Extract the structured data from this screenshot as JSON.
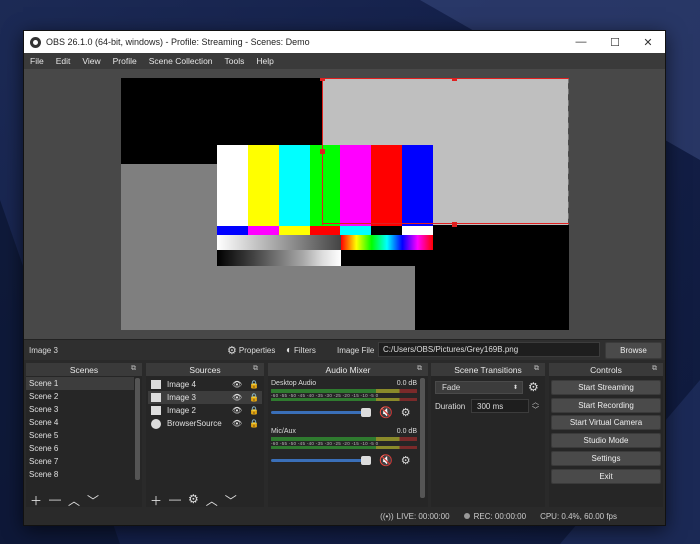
{
  "window": {
    "title": "OBS 26.1.0 (64-bit, windows) - Profile: Streaming - Scenes: Demo"
  },
  "menu": [
    "File",
    "Edit",
    "View",
    "Profile",
    "Scene Collection",
    "Tools",
    "Help"
  ],
  "properties_bar": {
    "source_name": "Image 3",
    "properties_label": "Properties",
    "filters_label": "Filters",
    "image_file_label": "Image File",
    "image_file_value": "C:/Users/OBS/Pictures/Grey169B.png",
    "browse_label": "Browse"
  },
  "scenes": {
    "title": "Scenes",
    "items": [
      "Scene 1",
      "Scene 2",
      "Scene 3",
      "Scene 4",
      "Scene 5",
      "Scene 6",
      "Scene 7",
      "Scene 8"
    ]
  },
  "sources": {
    "title": "Sources",
    "items": [
      "Image 4",
      "Image 3",
      "Image 2",
      "BrowserSource"
    ]
  },
  "mixer": {
    "title": "Audio Mixer",
    "tracks": [
      {
        "name": "Desktop Audio",
        "level": "0.0 dB",
        "volume": 0.85
      },
      {
        "name": "Mic/Aux",
        "level": "0.0 dB",
        "volume": 0.85
      }
    ],
    "ticks": "-60 -55 -50 -45 -40 -35 -30 -25 -20 -15 -10 -5 0"
  },
  "transitions": {
    "title": "Scene Transitions",
    "selected": "Fade",
    "duration_label": "Duration",
    "duration_value": "300 ms"
  },
  "controls": {
    "title": "Controls",
    "buttons": [
      "Start Streaming",
      "Start Recording",
      "Start Virtual Camera",
      "Studio Mode",
      "Settings",
      "Exit"
    ]
  },
  "status": {
    "live": "LIVE: 00:00:00",
    "rec": "REC: 00:00:00",
    "cpu": "CPU: 0.4%, 60.00 fps"
  },
  "colors": {
    "selection": "#e02020",
    "panel": "#262626",
    "button": "#4a4a4a"
  }
}
